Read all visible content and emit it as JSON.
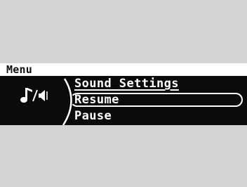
{
  "menu": {
    "title": "Menu",
    "icon": "music-note-speaker-icon",
    "items": [
      {
        "label": "Sound Settings"
      },
      {
        "label": "Resume",
        "selected": true
      },
      {
        "label": "Pause"
      }
    ]
  },
  "colors": {
    "screen_bg": "#0b0b0b",
    "text": "#ffffff",
    "title_bar": "#ffffff",
    "surround": "#d4d4d4"
  }
}
